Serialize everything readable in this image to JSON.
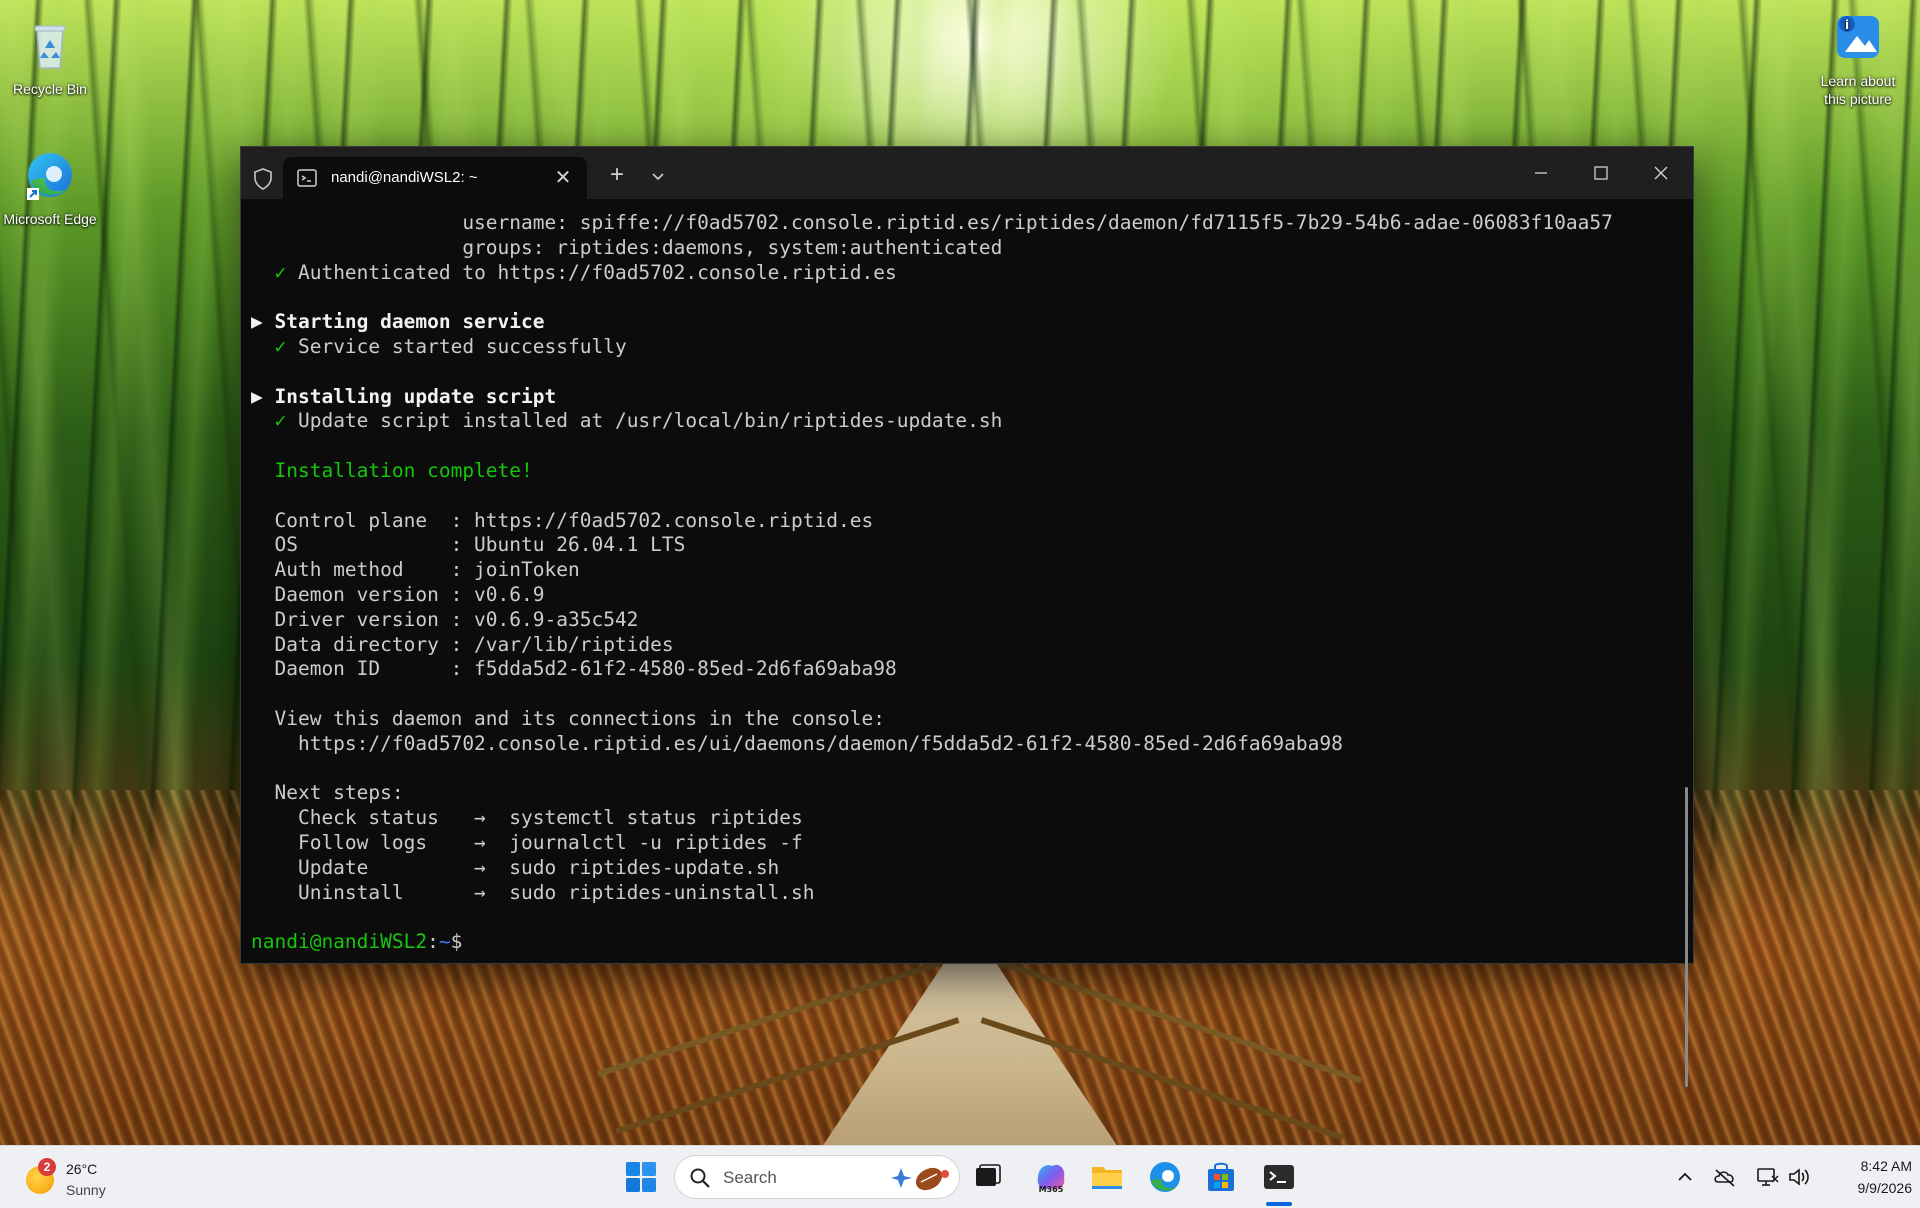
{
  "desktop": {
    "icons": [
      {
        "label": "Recycle Bin"
      },
      {
        "label": "Microsoft Edge"
      },
      {
        "label": "Learn about this picture"
      }
    ]
  },
  "window": {
    "tab_title": "nandi@nandiWSL2: ~",
    "tab_close": "✕",
    "new_tab": "+",
    "accent": "#16c60c"
  },
  "terminal": {
    "lines": [
      {
        "segments": [
          {
            "text": "                  username: spiffe://f0ad5702.console.riptid.es/riptides/daemon/fd7115f5-7b29-54b6-adae-06083f10aa57",
            "style": "plain"
          }
        ]
      },
      {
        "segments": [
          {
            "text": "                  groups: riptides:daemons, system:authenticated",
            "style": "plain"
          }
        ]
      },
      {
        "segments": [
          {
            "text": "  ✓",
            "style": "chk"
          },
          {
            "text": " Authenticated to https://f0ad5702.console.riptid.es",
            "style": "plain"
          }
        ]
      },
      {
        "segments": [
          {
            "text": "",
            "style": "plain"
          }
        ]
      },
      {
        "segments": [
          {
            "text": "▶ Starting daemon service",
            "style": "bold"
          }
        ]
      },
      {
        "segments": [
          {
            "text": "  ✓",
            "style": "chk"
          },
          {
            "text": " Service started successfully",
            "style": "plain"
          }
        ]
      },
      {
        "segments": [
          {
            "text": "",
            "style": "plain"
          }
        ]
      },
      {
        "segments": [
          {
            "text": "▶ Installing update script",
            "style": "bold"
          }
        ]
      },
      {
        "segments": [
          {
            "text": "  ✓",
            "style": "chk"
          },
          {
            "text": " Update script installed at /usr/local/bin/riptides-update.sh",
            "style": "plain"
          }
        ]
      },
      {
        "segments": [
          {
            "text": "",
            "style": "plain"
          }
        ]
      },
      {
        "segments": [
          {
            "text": "  Installation complete!",
            "style": "green"
          }
        ]
      },
      {
        "segments": [
          {
            "text": "",
            "style": "plain"
          }
        ]
      },
      {
        "segments": [
          {
            "text": "  Control plane  : https://f0ad5702.console.riptid.es",
            "style": "plain"
          }
        ]
      },
      {
        "segments": [
          {
            "text": "  OS             : Ubuntu 26.04.1 LTS",
            "style": "plain"
          }
        ]
      },
      {
        "segments": [
          {
            "text": "  Auth method    : joinToken",
            "style": "plain"
          }
        ]
      },
      {
        "segments": [
          {
            "text": "  Daemon version : v0.6.9",
            "style": "plain"
          }
        ]
      },
      {
        "segments": [
          {
            "text": "  Driver version : v0.6.9-a35c542",
            "style": "plain"
          }
        ]
      },
      {
        "segments": [
          {
            "text": "  Data directory : /var/lib/riptides",
            "style": "plain"
          }
        ]
      },
      {
        "segments": [
          {
            "text": "  Daemon ID      : f5dda5d2-61f2-4580-85ed-2d6fa69aba98",
            "style": "plain"
          }
        ]
      },
      {
        "segments": [
          {
            "text": "",
            "style": "plain"
          }
        ]
      },
      {
        "segments": [
          {
            "text": "  View this daemon and its connections in the console:",
            "style": "plain"
          }
        ]
      },
      {
        "segments": [
          {
            "text": "    https://f0ad5702.console.riptid.es/ui/daemons/daemon/f5dda5d2-61f2-4580-85ed-2d6fa69aba98",
            "style": "plain"
          }
        ]
      },
      {
        "segments": [
          {
            "text": "",
            "style": "plain"
          }
        ]
      },
      {
        "segments": [
          {
            "text": "  Next steps:",
            "style": "plain"
          }
        ]
      },
      {
        "segments": [
          {
            "text": "    Check status   →  systemctl status riptides",
            "style": "plain"
          }
        ]
      },
      {
        "segments": [
          {
            "text": "    Follow logs    →  journalctl -u riptides -f",
            "style": "plain"
          }
        ]
      },
      {
        "segments": [
          {
            "text": "    Update         →  sudo riptides-update.sh",
            "style": "plain"
          }
        ]
      },
      {
        "segments": [
          {
            "text": "    Uninstall      →  sudo riptides-uninstall.sh",
            "style": "plain"
          }
        ]
      },
      {
        "segments": [
          {
            "text": "",
            "style": "plain"
          }
        ]
      },
      {
        "segments": [
          {
            "text": "nandi@nandiWSL2",
            "style": "green"
          },
          {
            "text": ":",
            "style": "plain"
          },
          {
            "text": "~",
            "style": "blue"
          },
          {
            "text": "$",
            "style": "plain"
          }
        ]
      }
    ]
  },
  "taskbar": {
    "weather": {
      "badge": "2",
      "temp": "26°C",
      "condition": "Sunny"
    },
    "search_placeholder": "Search",
    "clock": {
      "time": "8:42 AM",
      "date": "9/9/2026"
    },
    "apps": [
      "start-icon",
      "task-view-icon",
      "m365-icon",
      "file-explorer-icon",
      "edge-icon",
      "store-icon",
      "terminal-icon"
    ]
  }
}
